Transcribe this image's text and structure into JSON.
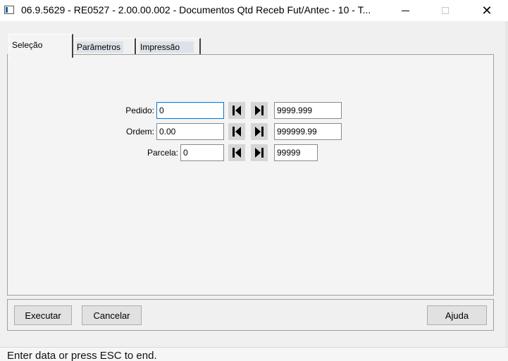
{
  "window": {
    "title": "06.9.5629 - RE0527 - 2.00.00.002 - Documentos Qtd Receb Fut/Antec - 10 - T...",
    "minimize_icon": "minimize-icon",
    "maximize_icon": "maximize-icon",
    "close_icon": "close-icon",
    "close_glyph": "✕"
  },
  "tabs": [
    {
      "label": "Seleção"
    },
    {
      "label": "Parâmetros"
    },
    {
      "label": "Impressão"
    }
  ],
  "form": {
    "pedido": {
      "label": "Pedido:",
      "from": "0",
      "to": "9999.999"
    },
    "ordem": {
      "label": "Ordem:",
      "from": "0.00",
      "to": "999999.99"
    },
    "parcela": {
      "label": "Parcela:",
      "from": "0",
      "to": "99999"
    }
  },
  "buttons": {
    "executar": "Executar",
    "cancelar": "Cancelar",
    "ajuda": "Ajuda"
  },
  "status": {
    "text": "Enter data or press ESC to end."
  },
  "colors": {
    "focus": "#0078d7",
    "client_bg": "#f0f0f0"
  }
}
